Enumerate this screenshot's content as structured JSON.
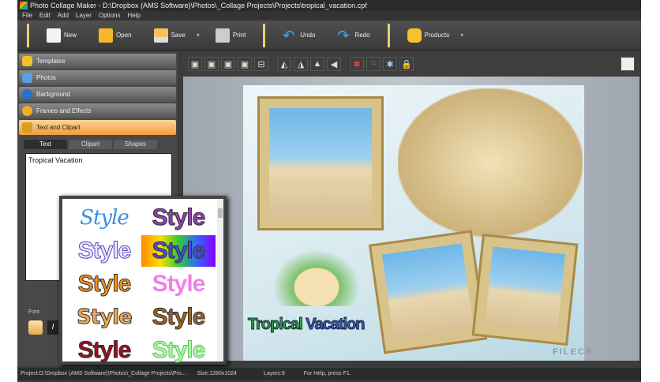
{
  "window": {
    "title": "Photo Collage Maker - D:\\Dropbox (AMS Software)\\Photos\\_Collage Projects\\Projects\\tropical_vacation.cpf"
  },
  "menu": [
    "File",
    "Edit",
    "Add",
    "Layer",
    "Options",
    "Help"
  ],
  "toolbar": {
    "new": "New",
    "open": "Open",
    "save": "Save",
    "print": "Print",
    "undo": "Undo",
    "redo": "Redo",
    "products": "Products"
  },
  "panels": [
    "Templates",
    "Photos",
    "Background",
    "Frames and Effects",
    "Text and Clipart"
  ],
  "tabs": [
    "Text",
    "Clipart",
    "Shapes"
  ],
  "text_input": "Tropical Vacation",
  "font_label": "Font",
  "font_italic": "I",
  "styles": [
    "Style",
    "Style",
    "Style",
    "Style",
    "Style",
    "Style",
    "Style",
    "Style",
    "Style",
    "Style"
  ],
  "canvas": {
    "text_part1": "Tropical ",
    "text_part2": "Vacation"
  },
  "status": {
    "project": "Project:D:\\Dropbox (AMS Software)\\Photos\\_Collage Projects\\Pro...",
    "size": "Size:1280x1024",
    "layers": "Layers:9",
    "help": "For Help, press F1."
  },
  "watermark": "FILECR"
}
